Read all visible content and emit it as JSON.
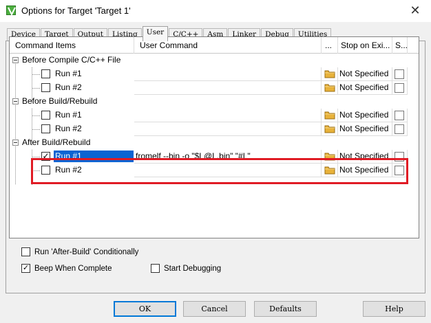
{
  "window": {
    "title": "Options for Target 'Target 1'",
    "close_glyph": "✕",
    "icon": "keil-vision-icon"
  },
  "tabs": [
    {
      "label": "Device"
    },
    {
      "label": "Target"
    },
    {
      "label": "Output"
    },
    {
      "label": "Listing"
    },
    {
      "label": "User",
      "active": true
    },
    {
      "label": "C/C++"
    },
    {
      "label": "Asm"
    },
    {
      "label": "Linker"
    },
    {
      "label": "Debug"
    },
    {
      "label": "Utilities"
    }
  ],
  "grid": {
    "headers": {
      "command_items": "Command Items",
      "user_command": "User Command",
      "browse": "...",
      "stop_on_exit": "Stop on Exi...",
      "s": "S..."
    },
    "groups": [
      {
        "label": "Before Compile C/C++ File",
        "items": [
          {
            "label": "Run #1",
            "checked": false,
            "command": "",
            "stop": "Not Specified"
          },
          {
            "label": "Run #2",
            "checked": false,
            "command": "",
            "stop": "Not Specified"
          }
        ]
      },
      {
        "label": "Before Build/Rebuild",
        "items": [
          {
            "label": "Run #1",
            "checked": false,
            "command": "",
            "stop": "Not Specified"
          },
          {
            "label": "Run #2",
            "checked": false,
            "command": "",
            "stop": "Not Specified"
          }
        ]
      },
      {
        "label": "After Build/Rebuild",
        "items": [
          {
            "label": "Run #1",
            "checked": true,
            "selected": true,
            "command": "fromelf --bin -o \"$L@L.bin\" \"#L\"",
            "stop": "Not Specified"
          },
          {
            "label": "Run #2",
            "checked": false,
            "command": "",
            "stop": "Not Specified"
          }
        ]
      }
    ]
  },
  "options": {
    "run_after_build": {
      "label": "Run 'After-Build' Conditionally",
      "checked": false
    },
    "beep_when_complete": {
      "label": "Beep When Complete",
      "checked": true
    },
    "start_debugging": {
      "label": "Start Debugging",
      "checked": false
    }
  },
  "buttons": {
    "ok": "OK",
    "cancel": "Cancel",
    "defaults": "Defaults",
    "help": "Help"
  },
  "colors": {
    "selection": "#0a64d2",
    "highlight_box": "#e01b24",
    "folder": "#e8b23a"
  }
}
